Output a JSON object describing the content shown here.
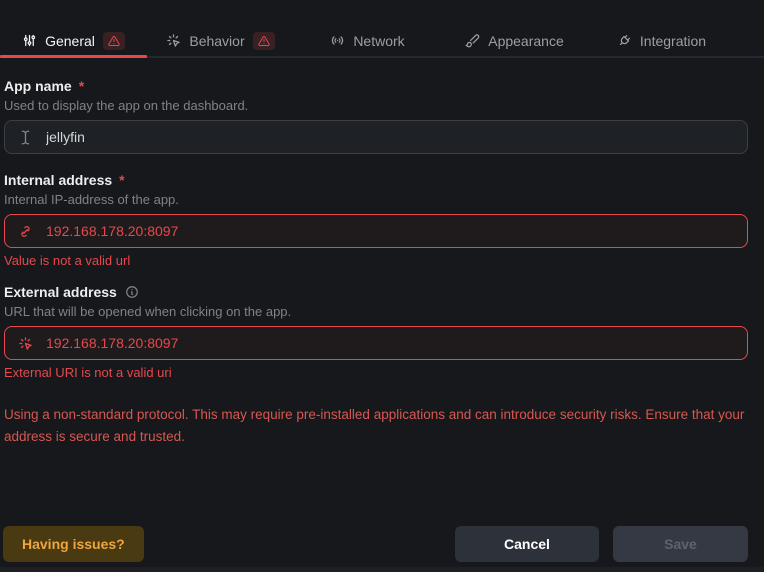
{
  "tabs": {
    "items": [
      {
        "label": "General",
        "icon": "sliders-icon",
        "active": true,
        "warning_badge": true
      },
      {
        "label": "Behavior",
        "icon": "pointer-click-icon",
        "active": false,
        "warning_badge": true
      },
      {
        "label": "Network",
        "icon": "broadcast-icon",
        "active": false,
        "warning_badge": false
      },
      {
        "label": "Appearance",
        "icon": "paintbrush-icon",
        "active": false,
        "warning_badge": false
      },
      {
        "label": "Integration",
        "icon": "plug-icon",
        "active": false,
        "warning_badge": false
      }
    ]
  },
  "form": {
    "app_name": {
      "label": "App name",
      "required_marker": "*",
      "description": "Used to display the app on the dashboard.",
      "value": "jellyfin",
      "icon": "text-cursor-icon"
    },
    "internal_address": {
      "label": "Internal address",
      "required_marker": "*",
      "description": "Internal IP-address of the app.",
      "value": "192.168.178.20:8097",
      "icon": "link-icon",
      "error": "Value is not a valid url"
    },
    "external_address": {
      "label": "External address",
      "description": "URL that will be opened when clicking on the app.",
      "value": "192.168.178.20:8097",
      "icon": "pointer-click-icon",
      "error": "External URI is not a valid uri"
    }
  },
  "warning_message": "Using a non-standard protocol. This may require pre-installed applications and can introduce security risks. Ensure that your address is secure and trusted.",
  "footer": {
    "having_issues_label": "Having issues?",
    "cancel_label": "Cancel",
    "save_label": "Save",
    "save_disabled": true
  },
  "colors": {
    "background": "#17181c",
    "accent_red": "#e5484d",
    "warning_text": "#d75750",
    "amber_button_bg": "#4a3a12",
    "amber_button_text": "#efa53d",
    "input_bg": "#1e2126",
    "input_border": "#3a3f46"
  }
}
